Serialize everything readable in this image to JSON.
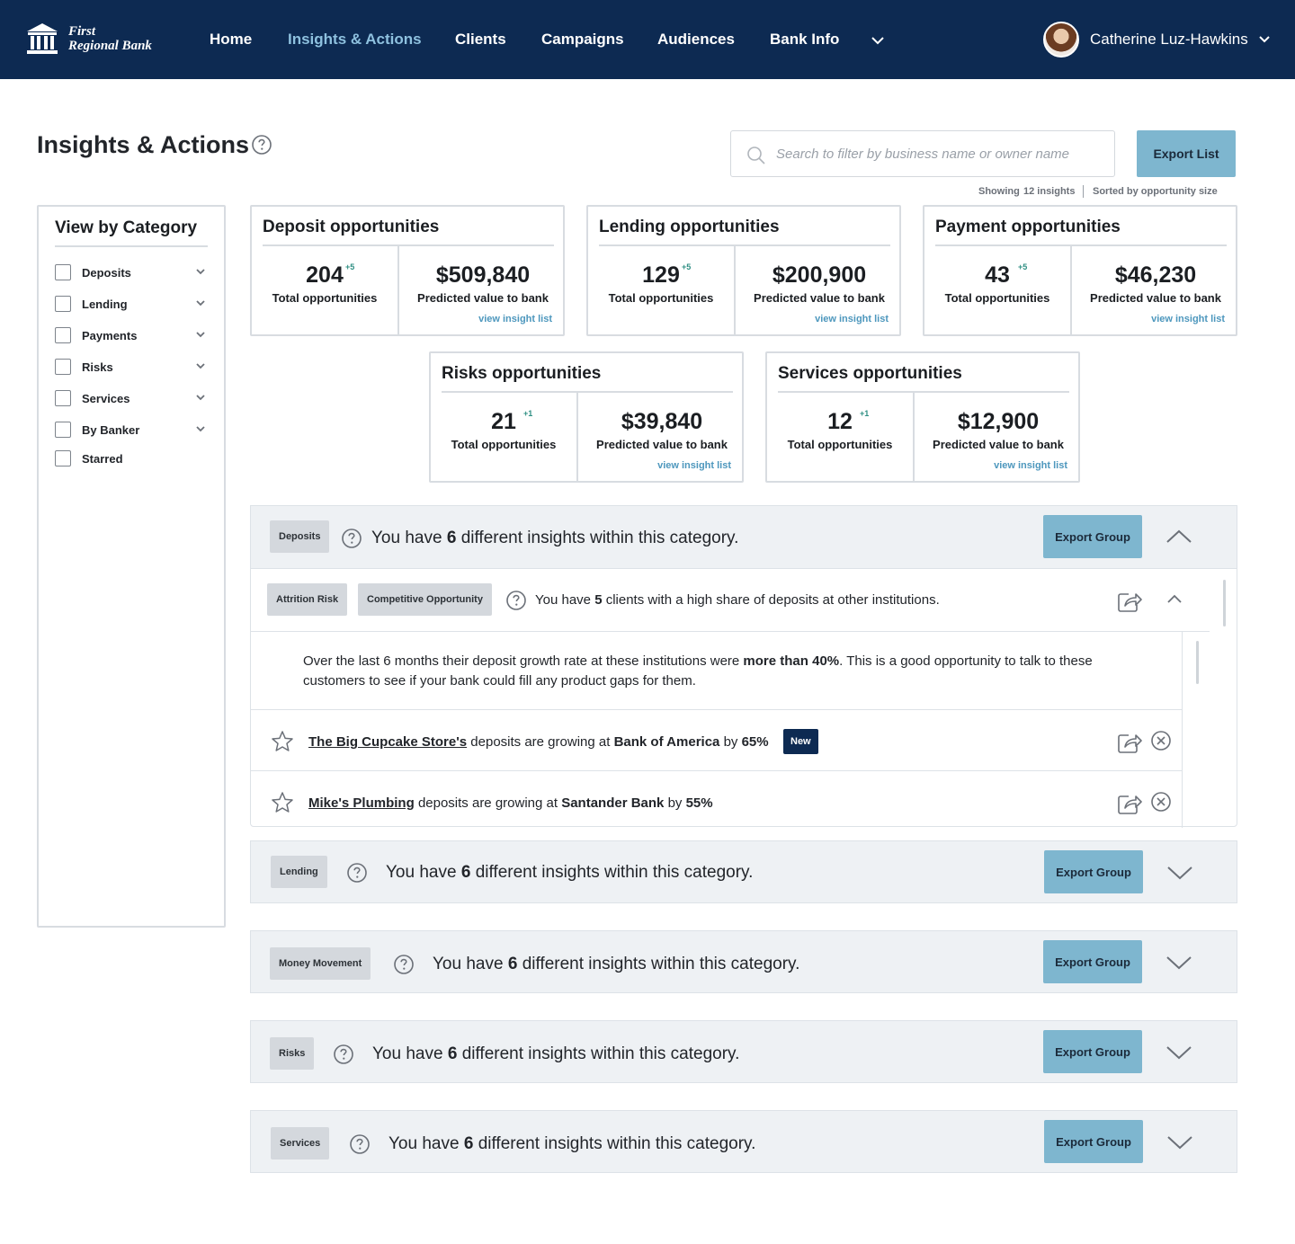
{
  "brand": {
    "name_line1": "First",
    "name_line2": "Regional Bank"
  },
  "nav": {
    "items": [
      "Home",
      "Insights & Actions",
      "Clients",
      "Campaigns",
      "Audiences",
      "Bank Info"
    ],
    "active": "Insights & Actions",
    "more_icon": "chevron-down-icon"
  },
  "user": {
    "name": "Catherine Luz-Hawkins"
  },
  "page": {
    "title": "Insights & Actions",
    "search_placeholder": "Search to filter by business name or owner name",
    "export_label": "Export List",
    "showing_prefix": "Showing",
    "showing_value": "12 insights",
    "sorted_by": "Sorted by opportunity size"
  },
  "sidebar": {
    "title": "View by Category",
    "categories": [
      {
        "label": "Deposits",
        "expandable": true
      },
      {
        "label": "Lending",
        "expandable": true
      },
      {
        "label": "Payments",
        "expandable": true
      },
      {
        "label": "Risks",
        "expandable": true
      },
      {
        "label": "Services",
        "expandable": true
      },
      {
        "label": "By Banker",
        "expandable": true
      },
      {
        "label": "Starred",
        "expandable": false
      }
    ]
  },
  "cards": [
    {
      "title": "Deposit opportunities",
      "count": "204",
      "delta": "+5",
      "count_label": "Total opportunities",
      "value": "$509,840",
      "value_label": "Predicted value to bank",
      "link": "view insight list"
    },
    {
      "title": "Lending opportunities",
      "count": "129",
      "delta": "+5",
      "count_label": "Total opportunities",
      "value": "$200,900",
      "value_label": "Predicted value to bank",
      "link": "view insight list"
    },
    {
      "title": "Payment opportunities",
      "count": "43",
      "delta": "+5",
      "count_label": "Total opportunities",
      "value": "$46,230",
      "value_label": "Predicted value to bank",
      "link": "view insight list"
    },
    {
      "title": "Risks opportunities",
      "count": "21",
      "delta": "+1",
      "count_label": "Total opportunities",
      "value": "$39,840",
      "value_label": "Predicted value to bank",
      "link": "view insight list"
    },
    {
      "title": "Services opportunities",
      "count": "12",
      "delta": "+1",
      "count_label": "Total opportunities",
      "value": "$12,900",
      "value_label": "Predicted value to bank",
      "link": "view insight list"
    }
  ],
  "groups": [
    {
      "tag": "Deposits",
      "text_pre": "You have",
      "count": "6",
      "text_post": "different insights within this category.",
      "export_label": "Export Group",
      "expanded": true
    },
    {
      "tag": "Lending",
      "text_pre": "You have",
      "count": "6",
      "text_post": "different insights within this category.",
      "export_label": "Export Group",
      "expanded": false
    },
    {
      "tag": "Money Movement",
      "text_pre": "You have",
      "count": "6",
      "text_post": "different insights within this category.",
      "export_label": "Export Group",
      "expanded": false
    },
    {
      "tag": "Risks",
      "text_pre": "You have",
      "count": "6",
      "text_post": "different insights within this category.",
      "export_label": "Export Group",
      "expanded": false
    },
    {
      "tag": "Services",
      "text_pre": "You have",
      "count": "6",
      "text_post": "different insights within this category.",
      "export_label": "Export Group",
      "expanded": false
    }
  ],
  "insight": {
    "tags": [
      "Attrition Risk",
      "Competitive Opportunity"
    ],
    "text_pre": "You have",
    "count": "5",
    "text_post": "clients with a high share of deposits at other institutions.",
    "desc_pre": "Over the last 6 months their deposit growth rate at these institutions were",
    "desc_bold": "more than 40%",
    "desc_post": ". This is a good opportunity to talk to these customers to see if your bank could fill any product gaps for them.",
    "rows": [
      {
        "business": "The Big Cupcake Store's",
        "mid": "deposits are growing at",
        "bank": "Bank of America",
        "by": "by",
        "pct": "65%",
        "badge": "New"
      },
      {
        "business": "Mike's Plumbing",
        "mid": "deposits are growing at",
        "bank": "Santander Bank",
        "by": "by",
        "pct": "55%",
        "badge": ""
      }
    ]
  }
}
